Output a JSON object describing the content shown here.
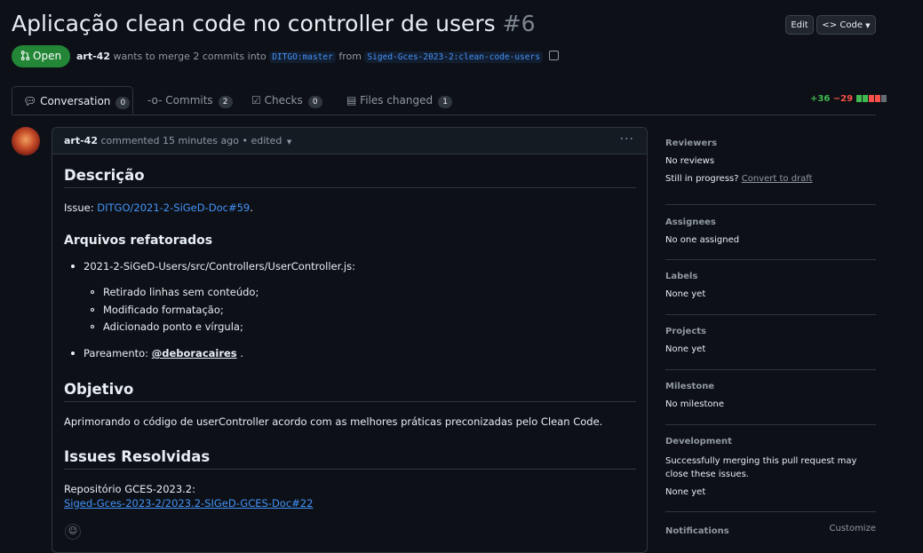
{
  "pr": {
    "title": "Aplicação clean code no controller de users",
    "number": "#6",
    "edit_label": "Edit",
    "code_label": "Code",
    "state": "Open",
    "author": "art-42",
    "merge_text": "wants to merge 2 commits into",
    "base_branch": "DITGO:master",
    "from_text": "from",
    "head_branch": "Siged-Gces-2023-2:clean-code-users"
  },
  "tabs": [
    {
      "label": "Conversation",
      "count": "0"
    },
    {
      "label": "Commits",
      "count": "2"
    },
    {
      "label": "Checks",
      "count": "0"
    },
    {
      "label": "Files changed",
      "count": "1"
    }
  ],
  "diffstat": {
    "additions": "+36",
    "deletions": "−29"
  },
  "comment": {
    "author": "art-42",
    "action": "commented 15 minutes ago • edited",
    "h_descricao": "Descrição",
    "issue_prefix": "Issue:",
    "issue_link": "DITGO/2021-2-SiGeD-Doc#59",
    "issue_suffix": ".",
    "h_arquivos": "Arquivos refatorados",
    "file_item": "2021-2-SiGeD-Users/src/Controllers/UserController.js:",
    "sub_items": [
      "Retirado linhas sem conteúdo;",
      "Modificado formatação;",
      "Adicionado ponto e vírgula;"
    ],
    "pair_prefix": "Pareamento:",
    "pair_user": "@deboracaires",
    "pair_suffix": ".",
    "h_objetivo": "Objetivo",
    "objetivo_text": "Aprimorando o código de userController acordo com as melhores práticas preconizadas pelo Clean Code.",
    "h_issues": "Issues Resolvidas",
    "repo_text": "Repositório GCES-2023.2:",
    "repo_link": "Siged-Gces-2023-2/2023.2-SIGeD-GCES-Doc#22"
  },
  "sidebar": {
    "reviewers_h": "Reviewers",
    "reviewers_v": "No reviews",
    "in_progress": "Still in progress?",
    "convert": "Convert to draft",
    "assignees_h": "Assignees",
    "assignees_v": "No one assigned",
    "labels_h": "Labels",
    "labels_v": "None yet",
    "projects_h": "Projects",
    "projects_v": "None yet",
    "milestone_h": "Milestone",
    "milestone_v": "No milestone",
    "development_h": "Development",
    "development_text": "Successfully merging this pull request may close these issues.",
    "development_v": "None yet",
    "notifications_h": "Notifications",
    "customize": "Customize"
  }
}
